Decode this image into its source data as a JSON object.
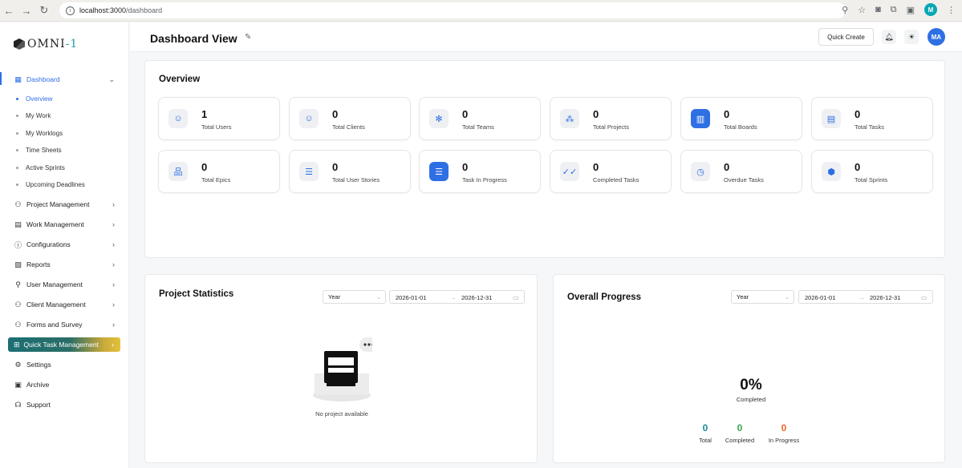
{
  "browser": {
    "url_host": "localhost:3000",
    "url_path": "/dashboard",
    "profile_initial": "M"
  },
  "logo": {
    "text_main": "OMNI",
    "text_suffix": "-1"
  },
  "sidebar": {
    "dashboard": "Dashboard",
    "sub_items": [
      "Overview",
      "My Work",
      "My Worklogs",
      "Time Sheets",
      "Active Sprints",
      "Upcoming Deadlines"
    ],
    "items": [
      {
        "label": "Project Management",
        "icon": "project-icon",
        "chevron": "›"
      },
      {
        "label": "Work Management",
        "icon": "briefcase-icon",
        "chevron": "›"
      },
      {
        "label": "Configurations",
        "icon": "info-icon",
        "chevron": "›"
      },
      {
        "label": "Reports",
        "icon": "report-icon",
        "chevron": "›"
      },
      {
        "label": "User Management",
        "icon": "user-icon",
        "chevron": "›"
      },
      {
        "label": "Client Management",
        "icon": "clients-icon",
        "chevron": "›"
      },
      {
        "label": "Forms and Survey",
        "icon": "form-icon",
        "chevron": "›"
      }
    ],
    "quick_task": "Quick Task Management",
    "settings": "Settings",
    "archive": "Archive",
    "support": "Support"
  },
  "header": {
    "title": "Dashboard View",
    "quick_create": "Quick Create",
    "avatar": "MA"
  },
  "overview": {
    "title": "Overview",
    "stats": [
      {
        "value": "1",
        "label": "Total Users",
        "icon": "users-icon"
      },
      {
        "value": "0",
        "label": "Total Clients",
        "icon": "clients-icon"
      },
      {
        "value": "0",
        "label": "Total Teams",
        "icon": "teams-icon"
      },
      {
        "value": "0",
        "label": "Total Projects",
        "icon": "projects-icon"
      },
      {
        "value": "0",
        "label": "Total Boards",
        "icon": "board-icon"
      },
      {
        "value": "0",
        "label": "Total Tasks",
        "icon": "clipboard-icon"
      },
      {
        "value": "0",
        "label": "Total Epics",
        "icon": "hierarchy-icon"
      },
      {
        "value": "0",
        "label": "Total User Stories",
        "icon": "list-icon"
      },
      {
        "value": "0",
        "label": "Task In Progress",
        "icon": "progress-icon"
      },
      {
        "value": "0",
        "label": "Completed Tasks",
        "icon": "double-check-icon"
      },
      {
        "value": "0",
        "label": "Overdue Tasks",
        "icon": "overdue-icon"
      },
      {
        "value": "0",
        "label": "Total Sprints",
        "icon": "sprint-icon"
      }
    ]
  },
  "project_statistics": {
    "title": "Project Statistics",
    "period": "Year",
    "date_start": "2026-01-01",
    "date_sep": "→",
    "date_end": "2026-12-31",
    "empty_text": "No project available"
  },
  "overall_progress": {
    "title": "Overall Progress",
    "period": "Year",
    "date_start": "2026-01-01",
    "date_sep": "→",
    "date_end": "2026-12-31",
    "percent": "0%",
    "percent_label": "Completed",
    "total_value": "0",
    "total_label": "Total",
    "completed_value": "0",
    "completed_label": "Completed",
    "in_progress_value": "0",
    "in_progress_label": "In Progress",
    "colors": {
      "total": "#1a8a9a",
      "completed": "#3ea34b",
      "in_progress": "#f0652a"
    }
  }
}
